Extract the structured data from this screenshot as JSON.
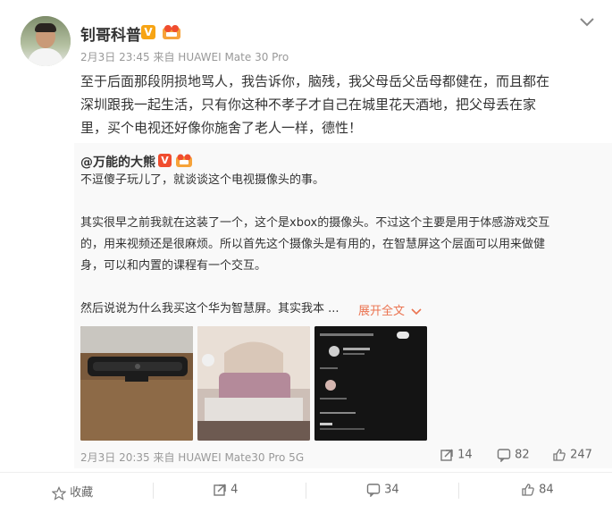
{
  "post": {
    "author": "钊哥科普",
    "meta": "2月3日 23:45 来自 HUAWEI Mate 30 Pro",
    "content_line1": "至于后面那段阴损地骂人，我告诉你，脑残，我父母岳父岳母都健在，而且都在",
    "content_line2": "深圳跟我一起生活，只有你这种不孝子才自己在城里花天酒地，把父母丢在家",
    "content_line3": "里，买个电视还好像你施舍了老人一样，德性！"
  },
  "repost": {
    "user": "@万能的大熊",
    "p1": "不逗傻子玩儿了，就谈谈这个电视摄像头的事。",
    "p2_line1": "其实很早之前我就在这装了一个，这个是xbox的摄像头。不过这个主要是用于体感游戏交互",
    "p2_line2": "的，用来视频还是很麻烦。所以首先这个摄像头是有用的，在智慧屏这个层面可以用来做健",
    "p2_line3": "身，可以和内置的课程有一个交互。",
    "p3": "然后说说为什么我买这个华为智慧屏。其实我本 ...",
    "expand_label": "展开全文",
    "meta": "2月3日 20:35 来自 HUAWEI Mate30 Pro 5G",
    "reposts": "14",
    "comments": "82",
    "likes": "247"
  },
  "actions": {
    "favorite": "收藏",
    "repost": "4",
    "comment": "34",
    "like": "84"
  },
  "colors": {
    "accent": "#eb7350",
    "badge_gold": "#f7a414",
    "badge_red": "#f04d2f"
  },
  "icons": [
    "chevron-down-icon",
    "verified-badge-icon",
    "fan-badge-icon",
    "repost-icon",
    "comment-icon",
    "like-icon",
    "star-icon"
  ]
}
